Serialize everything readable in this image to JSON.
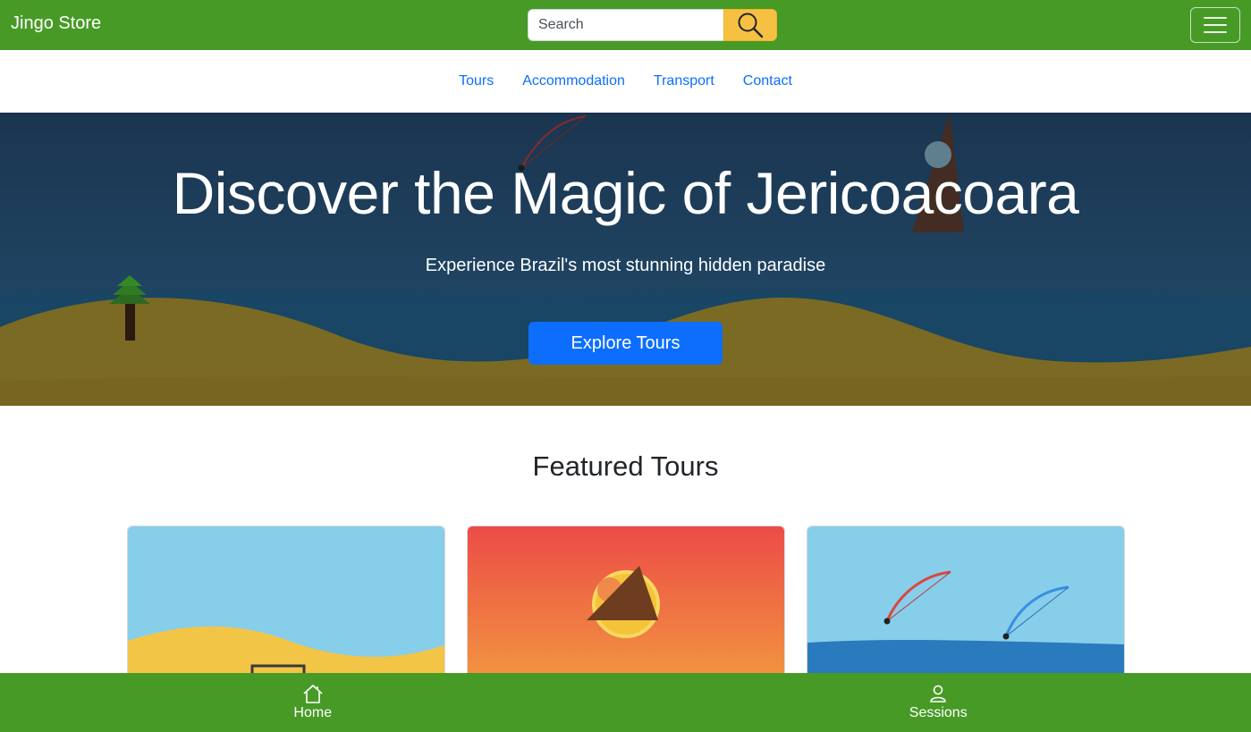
{
  "header": {
    "brand": "Jingo Store",
    "search": {
      "placeholder": "Search",
      "value": ""
    },
    "icons": {
      "search": "search-icon",
      "menu": "hamburger-icon"
    },
    "colors": {
      "bar": "#479a26",
      "search_button": "#f6c142"
    }
  },
  "nav": {
    "items": [
      {
        "label": "Tours"
      },
      {
        "label": "Accommodation"
      },
      {
        "label": "Transport"
      },
      {
        "label": "Contact"
      }
    ],
    "link_color": "#0d6efd"
  },
  "hero": {
    "title": "Discover the Magic of Jericoacoara",
    "subtitle": "Experience Brazil's most stunning hidden paradise",
    "cta": "Explore Tours",
    "cta_color": "#0d6efd"
  },
  "featured": {
    "title": "Featured Tours",
    "cards": [
      {
        "scene": "beach-dunes"
      },
      {
        "scene": "sunset-rock"
      },
      {
        "scene": "kitesurfing"
      }
    ]
  },
  "bottom_nav": {
    "items": [
      {
        "label": "Home",
        "icon": "home-icon"
      },
      {
        "label": "Sessions",
        "icon": "user-icon"
      }
    ]
  }
}
